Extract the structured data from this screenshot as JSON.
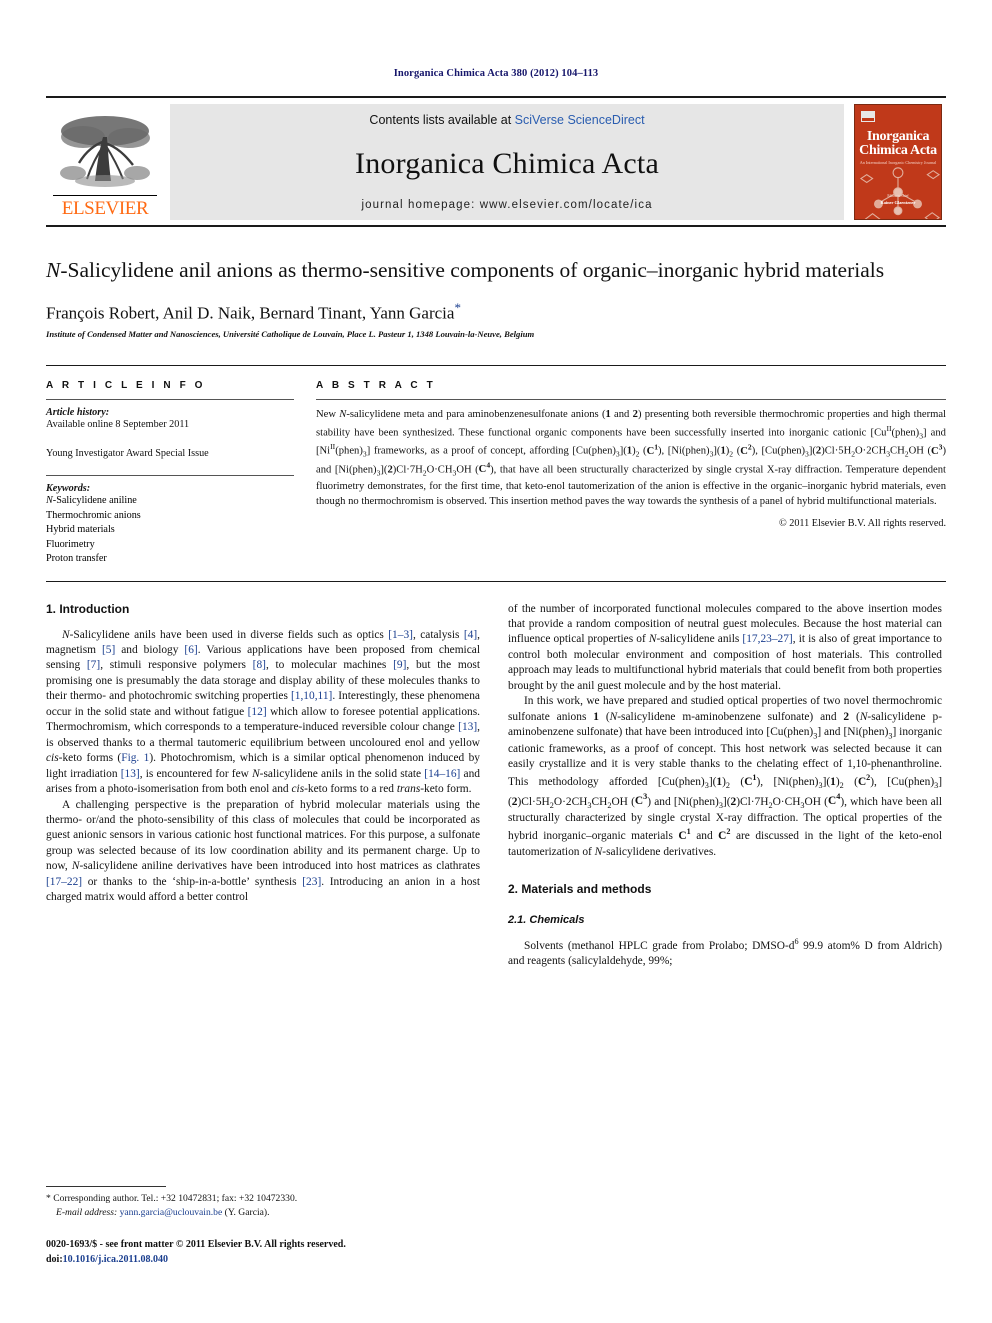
{
  "running_head": "Inorganica Chimica Acta 380 (2012) 104–113",
  "masthead": {
    "publisher_logo_text": "ELSEVIER",
    "contents_prefix": "Contents lists available at ",
    "contents_link": "SciVerse ScienceDirect",
    "journal_name": "Inorganica Chimica Acta",
    "homepage_line": "journal homepage: www.elsevier.com/locate/ica",
    "cover": {
      "line1": "Inorganica",
      "line2": "Chimica Acta",
      "subtitle": "An International Inorganic Chemistry Journal",
      "footer_editor_label": "Editor-in-chief",
      "footer_editor": "Rainer Glaentzner"
    }
  },
  "article": {
    "title_part1": "N",
    "title_rest": "-Salicylidene anil anions as thermo-sensitive components of organic–inorganic hybrid materials",
    "authors": "François Robert, Anil D. Naik, Bernard Tinant, Yann Garcia",
    "corresponding_marker": "*",
    "affiliation": "Institute of Condensed Matter and Nanosciences, Université Catholique de Louvain, Place L. Pasteur 1, 1348 Louvain-la-Neuve, Belgium"
  },
  "article_info": {
    "heading": "A R T I C L E   I N F O",
    "history_label": "Article history:",
    "history_value": "Available online 8 September 2011",
    "special_issue": "Young Investigator Award Special Issue",
    "keywords_label": "Keywords:",
    "keywords": [
      "N-Salicylidene aniline",
      "Thermochromic anions",
      "Hybrid materials",
      "Fluorimetry",
      "Proton transfer"
    ]
  },
  "abstract": {
    "heading": "A B S T R A C T",
    "text": "New N-salicylidene meta and para aminobenzenesulfonate anions (1 and 2) presenting both reversible thermochromic properties and high thermal stability have been synthesized. These functional organic components have been successfully inserted into inorganic cationic [CuII(phen)3] and [NiII(phen)3] frameworks, as a proof of concept, affording [Cu(phen)3](1)2 (C1), [Ni(phen)3](1)2 (C2), [Cu(phen)3](2)Cl·5H2O·2CH3CH2OH (C3) and [Ni(phen)3](2)Cl·7H2O·CH3OH (C4), that have all been structurally characterized by single crystal X-ray diffraction. Temperature dependent fluorimetry demonstrates, for the first time, that keto-enol tautomerization of the anion is effective in the organic–inorganic hybrid materials, even though no thermochromism is observed. This insertion method paves the way towards the synthesis of a panel of hybrid multifunctional materials.",
    "copyright": "© 2011 Elsevier B.V. All rights reserved."
  },
  "sections": {
    "introduction_heading": "1. Introduction",
    "materials_heading": "2. Materials and methods",
    "chemicals_heading": "2.1. Chemicals"
  },
  "body": {
    "left_p1": "N-Salicylidene anils have been used in diverse fields such as optics [1–3], catalysis [4], magnetism [5] and biology [6]. Various applications have been proposed from chemical sensing [7], stimuli responsive polymers [8], to molecular machines [9], but the most promising one is presumably the data storage and display ability of these molecules thanks to their thermo- and photochromic switching properties [1,10,11]. Interestingly, these phenomena occur in the solid state and without fatigue [12] which allow to foresee potential applications. Thermochromism, which corresponds to a temperature-induced reversible colour change [13], is observed thanks to a thermal tautomeric equilibrium between uncoloured enol and yellow cis-keto forms (Fig. 1). Photochromism, which is a similar optical phenomenon induced by light irradiation [13], is encountered for few N-salicylidene anils in the solid state [14–16] and arises from a photo-isomerisation from both enol and cis-keto forms to a red trans-keto form.",
    "left_p2": "A challenging perspective is the preparation of hybrid molecular materials using the thermo- or/and the photo-sensibility of this class of molecules that could be incorporated as guest anionic sensors in various cationic host functional matrices. For this purpose, a sulfonate group was selected because of its low coordination ability and its permanent charge. Up to now, N-salicylidene aniline derivatives have been introduced into host matrices as clathrates [17–22] or thanks to the 'ship-in-a-bottle' synthesis [23]. Introducing an anion in a host charged matrix would afford a better control",
    "right_p1": "of the number of incorporated functional molecules compared to the above insertion modes that provide a random composition of neutral guest molecules. Because the host material can influence optical properties of N-salicylidene anils [17,23–27], it is also of great importance to control both molecular environment and composition of host materials. This controlled approach may leads to multifunctional hybrid materials that could benefit from both properties brought by the anil guest molecule and by the host material.",
    "right_p2": "In this work, we have prepared and studied optical properties of two novel thermochromic sulfonate anions 1 (N-salicylidene m-aminobenzene sulfonate) and 2 (N-salicylidene p-aminobenzene sulfonate) that have been introduced into [Cu(phen)3] and [Ni(phen)3] inorganic cationic frameworks, as a proof of concept. This host network was selected because it can easily crystallize and it is very stable thanks to the chelating effect of 1,10-phenanthroline. This methodology afforded [Cu(phen)3](1)2 (C1), [Ni(phen)3](1)2 (C2), [Cu(phen)3](2)Cl·5H2O·2CH3CH2OH (C3) and [Ni(phen)3](2)Cl·7H2O·CH3OH (C4), which have been all structurally characterized by single crystal X-ray diffraction. The optical properties of the hybrid inorganic–organic materials C1 and C2 are discussed in the light of the keto-enol tautomerization of N-salicylidene derivatives.",
    "right_p3": "Solvents (methanol HPLC grade from Prolabo; DMSO-d6 99.9 atom% D from Aldrich) and reagents (salicylaldehyde, 99%;"
  },
  "footnote": {
    "star": "*",
    "corresponding": "Corresponding author. Tel.: +32 10472831; fax: +32 10472330.",
    "email_label": "E-mail address:",
    "email": "yann.garcia@uclouvain.be",
    "email_owner": "(Y. Garcia)."
  },
  "bottom": {
    "issn_line": "0020-1693/$ - see front matter © 2011 Elsevier B.V. All rights reserved.",
    "doi_label": "doi:",
    "doi_value": "10.1016/j.ica.2011.08.040"
  }
}
